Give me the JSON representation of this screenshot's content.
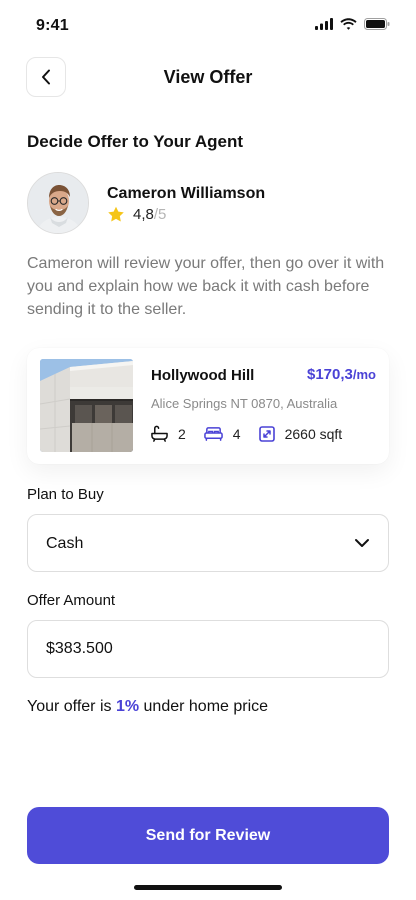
{
  "status_bar": {
    "time": "9:41"
  },
  "header": {
    "title": "View Offer"
  },
  "section": {
    "title": "Decide Offer to Your Agent"
  },
  "agent": {
    "name": "Cameron Williamson",
    "rating": "4,8",
    "rating_max": "/5",
    "description": "Cameron will review your offer, then go over it with you and explain how we back it with cash before sending it to the seller."
  },
  "property": {
    "name": "Hollywood Hill",
    "price": "$170,3",
    "price_period": "/mo",
    "address": "Alice Springs NT 0870, Australia",
    "bathrooms": "2",
    "bedrooms": "4",
    "area": "2660 sqft"
  },
  "form": {
    "plan_label": "Plan to Buy",
    "plan_value": "Cash",
    "amount_label": "Offer Amount",
    "amount_value": "$383.500"
  },
  "offer_note": {
    "prefix": "Your offer is",
    "percent": "1%",
    "suffix": "under home price"
  },
  "actions": {
    "submit_label": "Send for Review"
  },
  "colors": {
    "accent": "#4f4cd8",
    "price": "#4a42d6",
    "star": "#f5c518"
  }
}
